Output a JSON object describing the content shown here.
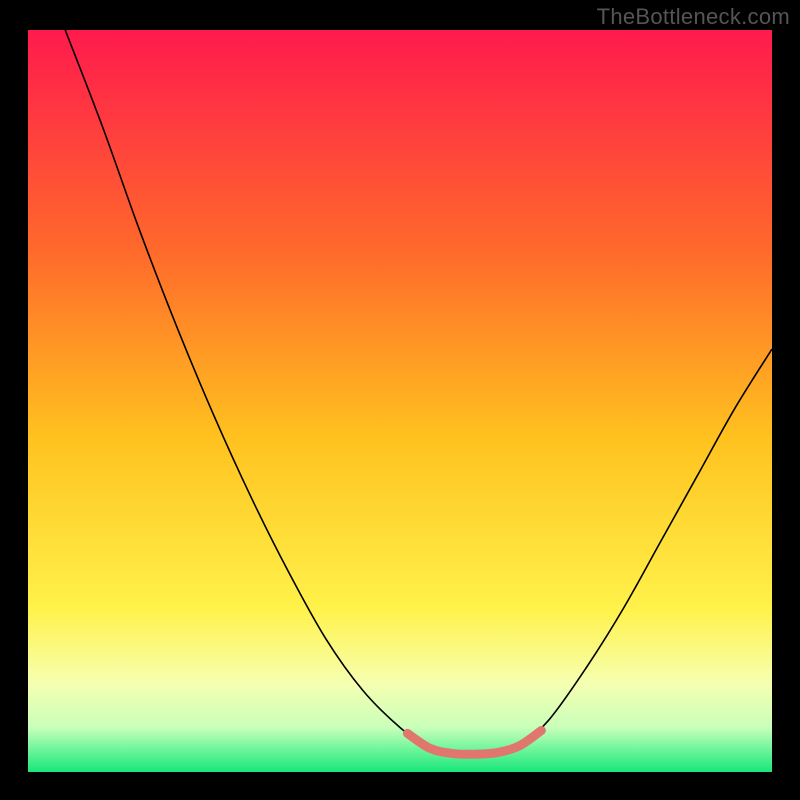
{
  "watermark": "TheBottleneck.com",
  "chart_data": {
    "type": "line",
    "title": "",
    "xlabel": "",
    "ylabel": "",
    "xlim": [
      0,
      100
    ],
    "ylim": [
      0,
      100
    ],
    "grid": false,
    "legend": false,
    "background_gradient": {
      "stops": [
        {
          "offset": 0.0,
          "color": "#ff1a4d"
        },
        {
          "offset": 0.3,
          "color": "#ff6a2b"
        },
        {
          "offset": 0.55,
          "color": "#ffc21f"
        },
        {
          "offset": 0.78,
          "color": "#fff24a"
        },
        {
          "offset": 0.88,
          "color": "#f6ffb0"
        },
        {
          "offset": 0.94,
          "color": "#c9ffba"
        },
        {
          "offset": 0.97,
          "color": "#6df59b"
        },
        {
          "offset": 1.0,
          "color": "#19e67a"
        }
      ]
    },
    "series": [
      {
        "name": "bottleneck-curve",
        "color": "#000000",
        "width": 1.6,
        "points": [
          {
            "x": 5,
            "y": 100
          },
          {
            "x": 10,
            "y": 87
          },
          {
            "x": 15,
            "y": 73
          },
          {
            "x": 20,
            "y": 60
          },
          {
            "x": 25,
            "y": 48
          },
          {
            "x": 30,
            "y": 37
          },
          {
            "x": 35,
            "y": 27
          },
          {
            "x": 40,
            "y": 18
          },
          {
            "x": 45,
            "y": 11
          },
          {
            "x": 50,
            "y": 6
          },
          {
            "x": 54,
            "y": 3.2
          },
          {
            "x": 57,
            "y": 2.5
          },
          {
            "x": 60,
            "y": 2.4
          },
          {
            "x": 63,
            "y": 2.6
          },
          {
            "x": 66,
            "y": 3.5
          },
          {
            "x": 70,
            "y": 7
          },
          {
            "x": 75,
            "y": 14
          },
          {
            "x": 80,
            "y": 22
          },
          {
            "x": 85,
            "y": 31
          },
          {
            "x": 90,
            "y": 40
          },
          {
            "x": 95,
            "y": 49
          },
          {
            "x": 100,
            "y": 57
          }
        ]
      },
      {
        "name": "valley-highlight",
        "color": "#e0766e",
        "width": 9,
        "linecap": "round",
        "points": [
          {
            "x": 51,
            "y": 5.2
          },
          {
            "x": 54,
            "y": 3.2
          },
          {
            "x": 57,
            "y": 2.5
          },
          {
            "x": 60,
            "y": 2.4
          },
          {
            "x": 63,
            "y": 2.6
          },
          {
            "x": 66,
            "y": 3.5
          },
          {
            "x": 69,
            "y": 5.6
          }
        ]
      }
    ]
  }
}
